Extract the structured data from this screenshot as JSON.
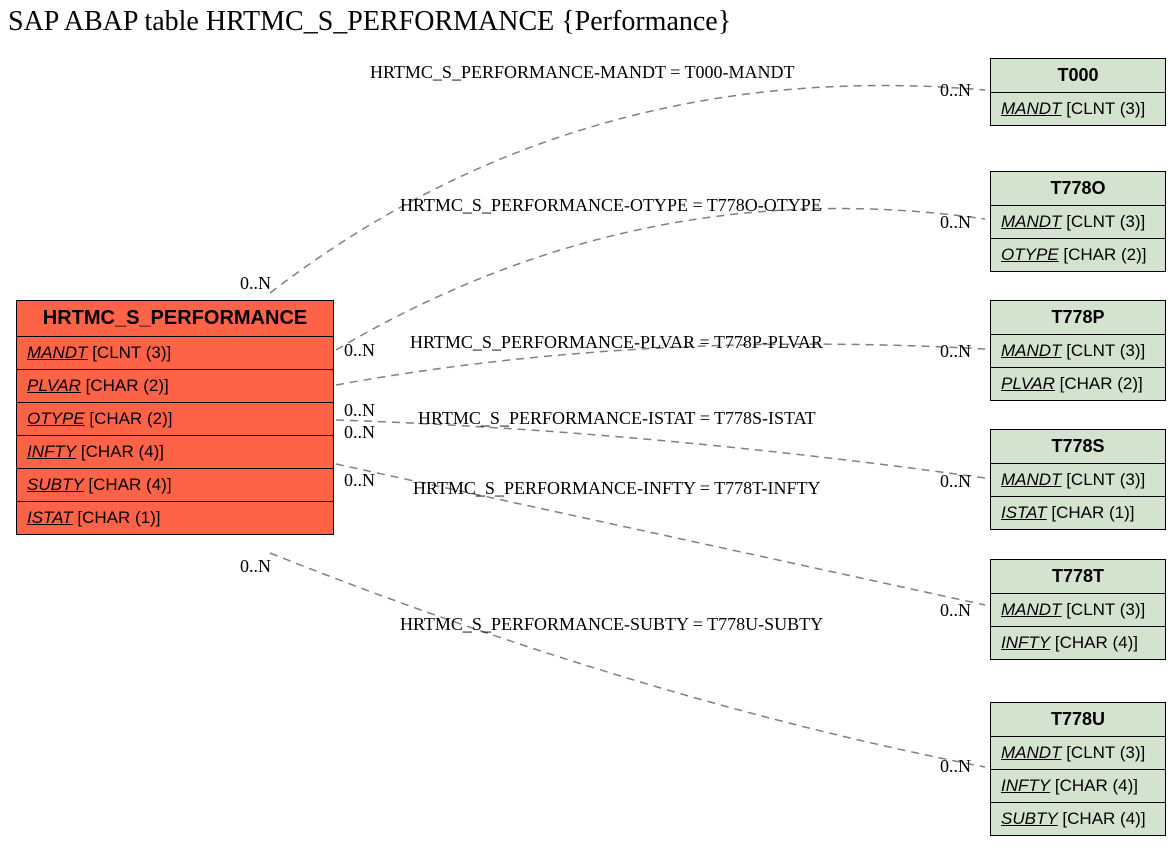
{
  "title": "SAP ABAP table HRTMC_S_PERFORMANCE {Performance}",
  "main": {
    "name": "HRTMC_S_PERFORMANCE",
    "fields": [
      {
        "name": "MANDT",
        "type": "[CLNT (3)]"
      },
      {
        "name": "PLVAR",
        "type": "[CHAR (2)]"
      },
      {
        "name": "OTYPE",
        "type": "[CHAR (2)]"
      },
      {
        "name": "INFTY",
        "type": "[CHAR (4)]"
      },
      {
        "name": "SUBTY",
        "type": "[CHAR (4)]"
      },
      {
        "name": "ISTAT",
        "type": "[CHAR (1)]"
      }
    ]
  },
  "relations": [
    {
      "label": "HRTMC_S_PERFORMANCE-MANDT = T000-MANDT"
    },
    {
      "label": "HRTMC_S_PERFORMANCE-OTYPE = T778O-OTYPE"
    },
    {
      "label": "HRTMC_S_PERFORMANCE-PLVAR = T778P-PLVAR"
    },
    {
      "label": "HRTMC_S_PERFORMANCE-ISTAT = T778S-ISTAT"
    },
    {
      "label": "HRTMC_S_PERFORMANCE-INFTY = T778T-INFTY"
    },
    {
      "label": "HRTMC_S_PERFORMANCE-SUBTY = T778U-SUBTY"
    }
  ],
  "targets": [
    {
      "name": "T000",
      "fields": [
        {
          "name": "MANDT",
          "type": "[CLNT (3)]"
        }
      ]
    },
    {
      "name": "T778O",
      "fields": [
        {
          "name": "MANDT",
          "type": "[CLNT (3)]"
        },
        {
          "name": "OTYPE",
          "type": "[CHAR (2)]"
        }
      ]
    },
    {
      "name": "T778P",
      "fields": [
        {
          "name": "MANDT",
          "type": "[CLNT (3)]"
        },
        {
          "name": "PLVAR",
          "type": "[CHAR (2)]"
        }
      ]
    },
    {
      "name": "T778S",
      "fields": [
        {
          "name": "MANDT",
          "type": "[CLNT (3)]"
        },
        {
          "name": "ISTAT",
          "type": "[CHAR (1)]"
        }
      ]
    },
    {
      "name": "T778T",
      "fields": [
        {
          "name": "MANDT",
          "type": "[CLNT (3)]"
        },
        {
          "name": "INFTY",
          "type": "[CHAR (4)]"
        }
      ]
    },
    {
      "name": "T778U",
      "fields": [
        {
          "name": "MANDT",
          "type": "[CLNT (3)]"
        },
        {
          "name": "INFTY",
          "type": "[CHAR (4)]"
        },
        {
          "name": "SUBTY",
          "type": "[CHAR (4)]"
        }
      ]
    }
  ],
  "card": "0..N",
  "colors": {
    "main_bg": "#ff6347",
    "ref_bg": "#d4e2d0"
  }
}
